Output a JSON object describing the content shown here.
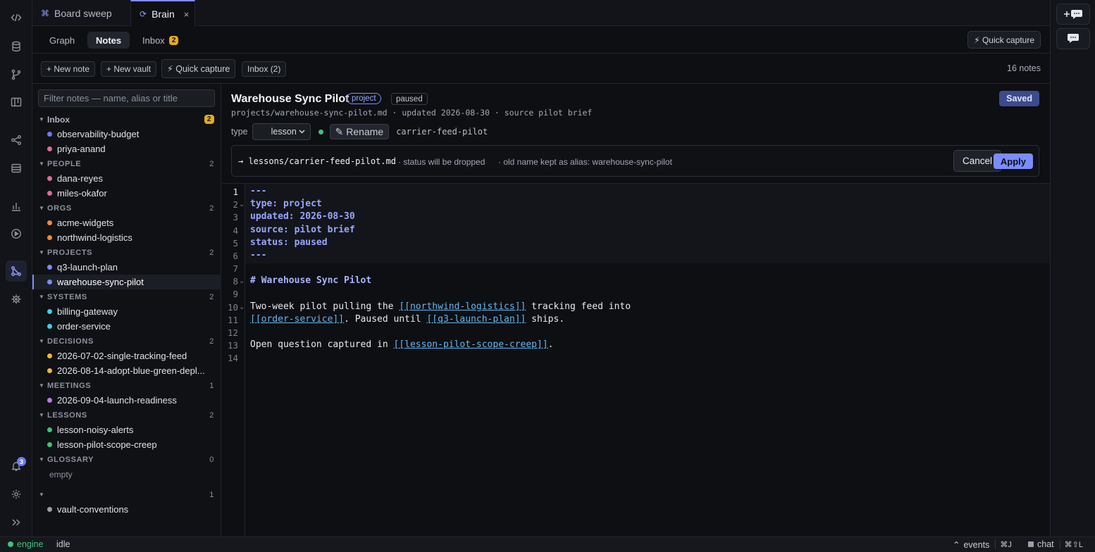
{
  "tabs": [
    {
      "label": "Board sweep",
      "active": false
    },
    {
      "label": "Brain",
      "active": true,
      "close": "×"
    }
  ],
  "views": {
    "graph": "Graph",
    "notes": "Notes",
    "inbox": "Inbox",
    "inbox_badge": "2",
    "quick_capture": "⚡ Quick capture"
  },
  "toolbar": {
    "new_note": "+ New note",
    "new_vault": "+ New vault",
    "quick_capture": "⚡ Quick capture",
    "inbox": "Inbox (2)",
    "note_count": "16 notes"
  },
  "sidebar": {
    "filter_placeholder": "Filter notes — name, alias or title",
    "inbox": {
      "label": "Inbox",
      "badge": "2",
      "items": [
        "observability-budget",
        "priya-anand"
      ]
    },
    "groups": [
      {
        "label": "PEOPLE",
        "count": "2",
        "items": [
          "dana-reyes",
          "miles-okafor"
        ]
      },
      {
        "label": "ORGS",
        "count": "2",
        "items": [
          "acme-widgets",
          "northwind-logistics"
        ]
      },
      {
        "label": "PROJECTS",
        "count": "2",
        "items": [
          "q3-launch-plan",
          "warehouse-sync-pilot"
        ]
      },
      {
        "label": "SYSTEMS",
        "count": "2",
        "items": [
          "billing-gateway",
          "order-service"
        ]
      },
      {
        "label": "DECISIONS",
        "count": "2",
        "items": [
          "2026-07-02-single-tracking-feed",
          "2026-08-14-adopt-blue-green-depl..."
        ]
      },
      {
        "label": "MEETINGS",
        "count": "1",
        "items": [
          "2026-09-04-launch-readiness"
        ]
      },
      {
        "label": "LESSONS",
        "count": "2",
        "items": [
          "lesson-noisy-alerts",
          "lesson-pilot-scope-creep"
        ]
      },
      {
        "label": "GLOSSARY",
        "count": "0",
        "empty": "empty"
      },
      {
        "label": "",
        "count": "1",
        "items": [
          "vault-conventions"
        ]
      }
    ],
    "selected": "warehouse-sync-pilot"
  },
  "note": {
    "title": "Warehouse Sync Pilot",
    "type_tag": "project",
    "status_tag": "paused",
    "saved": "Saved",
    "meta": "projects/warehouse-sync-pilot.md · updated 2026-08-30 · source pilot brief",
    "type_label": "type",
    "type_value": "lesson",
    "rename_label": "✎ Rename",
    "rename_value": "carrier-feed-pilot",
    "rename_preview": {
      "path": "→ lessons/carrier-feed-pilot.md",
      "note1": "· status will be dropped",
      "note2": "· old name kept as alias: warehouse-sync-pilot",
      "cancel": "Cancel",
      "apply": "Apply"
    }
  },
  "editor": {
    "line_numbers": [
      "1",
      "2",
      "3",
      "4",
      "5",
      "6",
      "7",
      "8",
      "9",
      "10",
      "11",
      "12",
      "13",
      "14"
    ],
    "lines": {
      "l1": "---",
      "l2": "type: project",
      "l3": "updated: 2026-08-30",
      "l4": "source: pilot brief",
      "l5": "status: paused",
      "l6": "---",
      "l8": "# Warehouse Sync Pilot",
      "l10a": "Two-week pilot pulling the ",
      "l10link": "[[northwind-logistics]]",
      "l10b": " tracking feed into",
      "l11link1": "[[order-service]]",
      "l11a": ". Paused until ",
      "l11link2": "[[q3-launch-plan]]",
      "l11b": " ships.",
      "l13a": "Open question captured in ",
      "l13link": "[[lesson-pilot-scope-creep]]",
      "l13b": "."
    }
  },
  "activity_bar": {
    "icons": [
      "code-icon",
      "database-icon",
      "git-branch-icon",
      "kanban-icon",
      "share-graph-icon",
      "layers-icon",
      "bar-chart-icon",
      "play-icon",
      "brain-graph-icon",
      "cpu-icon"
    ],
    "notification_badge": "3"
  },
  "status": {
    "engine": "engine",
    "state": "idle",
    "events": "events",
    "events_kbd": "⌘J",
    "chat": "chat",
    "chat_kbd": "⌘⇧L"
  },
  "colors": {
    "accent": "#7b8cff",
    "inbox_dot": "#6c7cf0",
    "people_dot": "#e06c9a",
    "orgs_dot": "#f08a3c",
    "projects_dot": "#7b8cff",
    "systems_dot": "#3fd0e8",
    "decisions_dot": "#f2b53a",
    "meetings_dot": "#c07ae8",
    "lessons_dot": "#3ec37d",
    "other_dot": "#9a9fa8",
    "badge": "#e5a824"
  }
}
